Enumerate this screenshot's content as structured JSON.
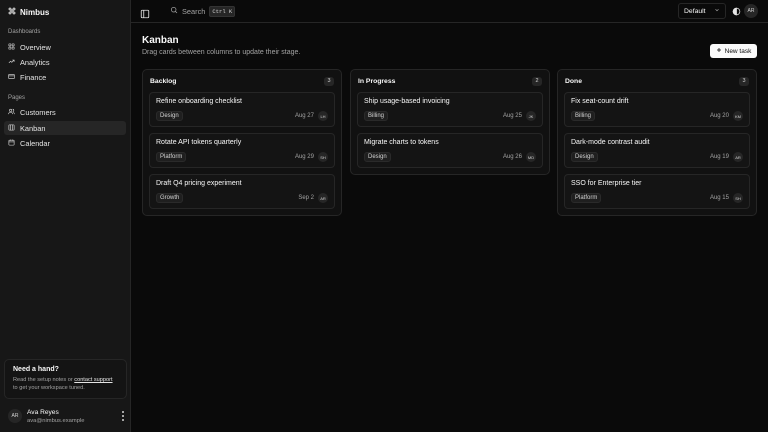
{
  "brand": {
    "name": "Nimbus"
  },
  "sidebar": {
    "groups": [
      {
        "label": "Dashboards",
        "items": [
          {
            "label": "Overview"
          },
          {
            "label": "Analytics"
          },
          {
            "label": "Finance"
          }
        ]
      },
      {
        "label": "Pages",
        "items": [
          {
            "label": "Customers"
          },
          {
            "label": "Kanban"
          },
          {
            "label": "Calendar"
          }
        ]
      }
    ],
    "active_item": "Kanban",
    "help": {
      "title": "Need a hand?",
      "text_before": "Read the setup notes or",
      "link": "contact support",
      "text_after": "to get your workspace tuned."
    },
    "user": {
      "initials": "AR",
      "name": "Ava Reyes",
      "email": "ava@nimbus.example"
    }
  },
  "topbar": {
    "search_label": "Search",
    "search_shortcut": "Ctrl K",
    "theme_value": "Default",
    "avatar_initials": "AR"
  },
  "page": {
    "title": "Kanban",
    "subtitle": "Drag cards between columns to update their stage.",
    "new_task_label": "New task"
  },
  "columns": [
    {
      "title": "Backlog",
      "count": "3",
      "cards": [
        {
          "title": "Refine onboarding checklist",
          "tag": "Design",
          "date": "Aug 27",
          "assignee": "LH"
        },
        {
          "title": "Rotate API tokens quarterly",
          "tag": "Platform",
          "date": "Aug 29",
          "assignee": "SH"
        },
        {
          "title": "Draft Q4 pricing experiment",
          "tag": "Growth",
          "date": "Sep 2",
          "assignee": "AR"
        }
      ]
    },
    {
      "title": "In Progress",
      "count": "2",
      "cards": [
        {
          "title": "Ship usage-based invoicing",
          "tag": "Billing",
          "date": "Aug 25",
          "assignee": "JK"
        },
        {
          "title": "Migrate charts to tokens",
          "tag": "Design",
          "date": "Aug 26",
          "assignee": "MD"
        }
      ]
    },
    {
      "title": "Done",
      "count": "3",
      "cards": [
        {
          "title": "Fix seat-count drift",
          "tag": "Billing",
          "date": "Aug 20",
          "assignee": "KM"
        },
        {
          "title": "Dark-mode contrast audit",
          "tag": "Design",
          "date": "Aug 19",
          "assignee": "AR"
        },
        {
          "title": "SSO for Enterprise tier",
          "tag": "Platform",
          "date": "Aug 15",
          "assignee": "SH"
        }
      ]
    }
  ],
  "colors": {
    "background": "#0a0a0a",
    "sidebar": "#171717",
    "border": "#262626",
    "primary_button": "#fafafa"
  }
}
